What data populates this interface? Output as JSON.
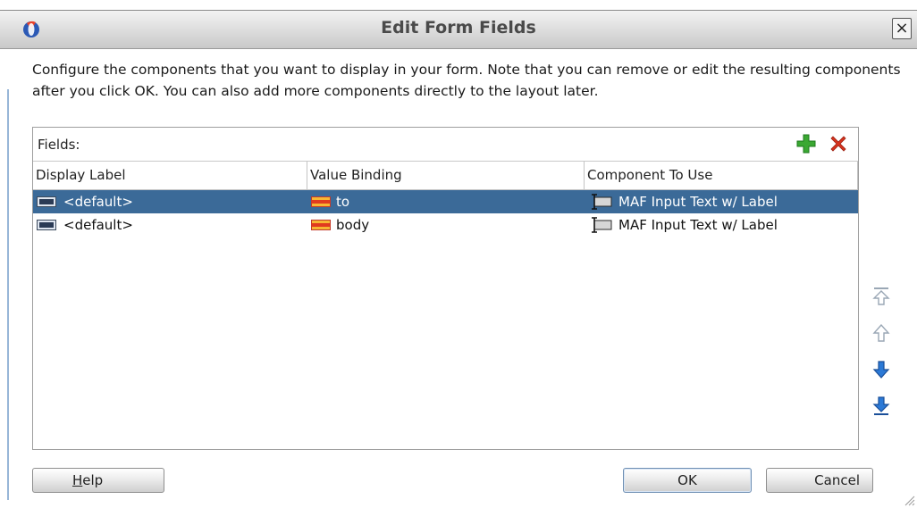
{
  "dialog": {
    "title": "Edit Form Fields",
    "close_glyph": "×",
    "app_icon": "oracle-jdeveloper-icon"
  },
  "description": "Configure the components that you want to display in your form.  Note that you can remove or edit the resulting components after you click OK.  You can also add more components directly to the layout later.",
  "fields_panel": {
    "label": "Fields:",
    "add_icon": "green-plus-icon",
    "remove_icon": "red-x-icon",
    "columns": [
      "Display Label",
      "Value Binding",
      "Component To Use"
    ],
    "rows": [
      {
        "display_label": "<default>",
        "value_binding": "to",
        "component": "MAF Input Text w/ Label",
        "selected": true
      },
      {
        "display_label": "<default>",
        "value_binding": "body",
        "component": "MAF Input Text w/ Label",
        "selected": false
      }
    ]
  },
  "side_buttons": {
    "icons": [
      "move-top-icon",
      "move-up-icon",
      "move-down-icon",
      "move-bottom-icon"
    ]
  },
  "buttons": {
    "help_label": "Help",
    "help_mnemonic": "H",
    "help_rest": "elp",
    "ok_label": "OK",
    "cancel_label": "Cancel"
  },
  "colors": {
    "selection": "#3b6a98",
    "arrow_blue": "#2b79d6",
    "add_green": "#3aa832",
    "remove_red": "#d8331e"
  }
}
